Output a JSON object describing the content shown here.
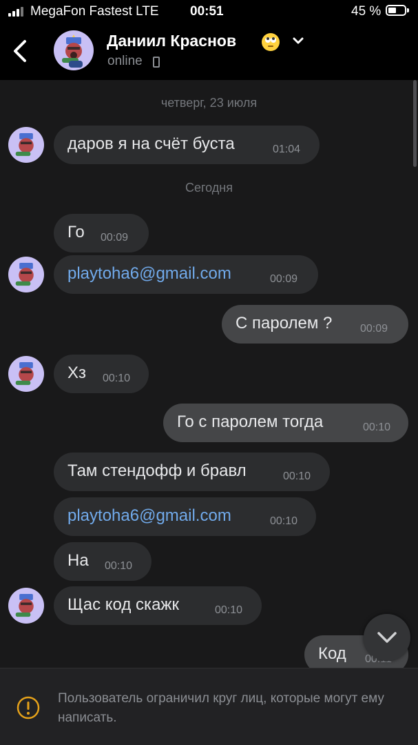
{
  "status": {
    "carrier": "MegaFon Fastest  LTE",
    "time": "00:51",
    "battery": "45 %",
    "battery_level": 0.45
  },
  "header": {
    "name": "Даниил Краснов",
    "emoji": "eye-roll-emoji",
    "status": "online"
  },
  "dates": {
    "d1": "четверг, 23 июля",
    "d2": "Сегодня"
  },
  "messages": [
    {
      "text": "даров я на счёт буста",
      "time": "01:04"
    },
    {
      "text": "Го",
      "time": "00:09"
    },
    {
      "text": "playtoha6@gmail.com",
      "time": "00:09"
    },
    {
      "text": "С паролем ?",
      "time": "00:09"
    },
    {
      "text": "Хз",
      "time": "00:10"
    },
    {
      "text": "Го с паролем тогда",
      "time": "00:10"
    },
    {
      "text": "Там стендофф и бравл",
      "time": "00:10"
    },
    {
      "text": "playtoha6@gmail.com",
      "time": "00:10"
    },
    {
      "text": "На",
      "time": "00:10"
    },
    {
      "text": "Щас код скажк",
      "time": "00:10"
    },
    {
      "text": "Код",
      "time": "00:11"
    }
  ],
  "footer": {
    "notice": "Пользователь ограничил круг лиц, которые могут ему написать."
  },
  "colors": {
    "link": "#71aaeb",
    "incoming": "#2c2d2f",
    "outgoing": "#454648",
    "background": "#19191a"
  }
}
